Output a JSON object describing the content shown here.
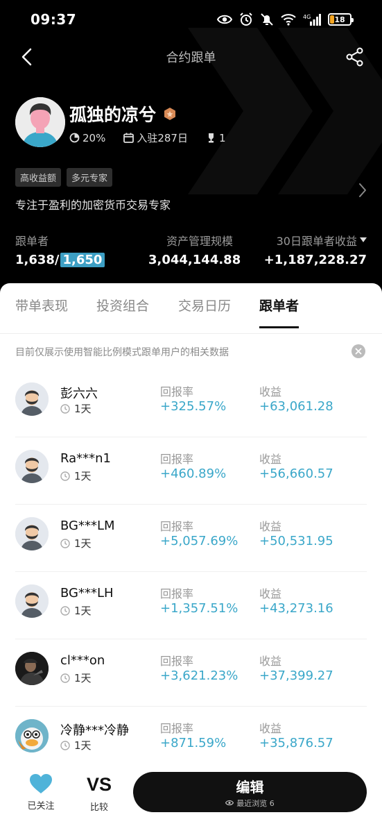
{
  "status_bar": {
    "time": "09:37",
    "battery": "18"
  },
  "nav": {
    "title": "合约跟单"
  },
  "profile": {
    "name": "孤独的凉兮",
    "win_ratio": "20%",
    "settled_days": "入驻287日",
    "rank": "1",
    "tags": [
      "高收益额",
      "多元专家"
    ],
    "bio": "专注于盈利的加密货币交易专家"
  },
  "metrics": {
    "followers_label": "跟单者",
    "followers_value": "1,638/",
    "followers_cap": "1,650",
    "aum_label": "资产管理规模",
    "aum_value": "3,044,144.88",
    "pnl_label": "30日跟单者收益",
    "pnl_value": "+1,187,228.27"
  },
  "tabs": [
    "带单表现",
    "投资组合",
    "交易日历",
    "跟单者"
  ],
  "active_tab": "跟单者",
  "notice": "目前仅展示使用智能比例模式跟单用户的相关数据",
  "followers": [
    {
      "name": "彭六六",
      "duration": "1天",
      "roi_label": "回报率",
      "roi": "+325.57%",
      "pnl_label": "收益",
      "pnl": "+63,061.28"
    },
    {
      "name": "Ra***n1",
      "duration": "1天",
      "roi_label": "回报率",
      "roi": "+460.89%",
      "pnl_label": "收益",
      "pnl": "+56,660.57"
    },
    {
      "name": "BG***LM",
      "duration": "1天",
      "roi_label": "回报率",
      "roi": "+5,057.69%",
      "pnl_label": "收益",
      "pnl": "+50,531.95"
    },
    {
      "name": "BG***LH",
      "duration": "1天",
      "roi_label": "回报率",
      "roi": "+1,357.51%",
      "pnl_label": "收益",
      "pnl": "+43,273.16"
    },
    {
      "name": "cl***on",
      "duration": "1天",
      "roi_label": "回报率",
      "roi": "+3,621.23%",
      "pnl_label": "收益",
      "pnl": "+37,399.27"
    },
    {
      "name": "冷静***冷静",
      "duration": "1天",
      "roi_label": "回报率",
      "roi": "+871.59%",
      "pnl_label": "收益",
      "pnl": "+35,876.57"
    }
  ],
  "bottom": {
    "follow_label": "已关注",
    "compare_icon_text": "VS",
    "compare_label": "比较",
    "edit_label": "编辑",
    "recent_views": "最近浏览 6"
  },
  "colors": {
    "accent": "#3aa7c9",
    "heart": "#4fb3d9",
    "cap_box": "#3d9fc4",
    "background": "#000000"
  }
}
